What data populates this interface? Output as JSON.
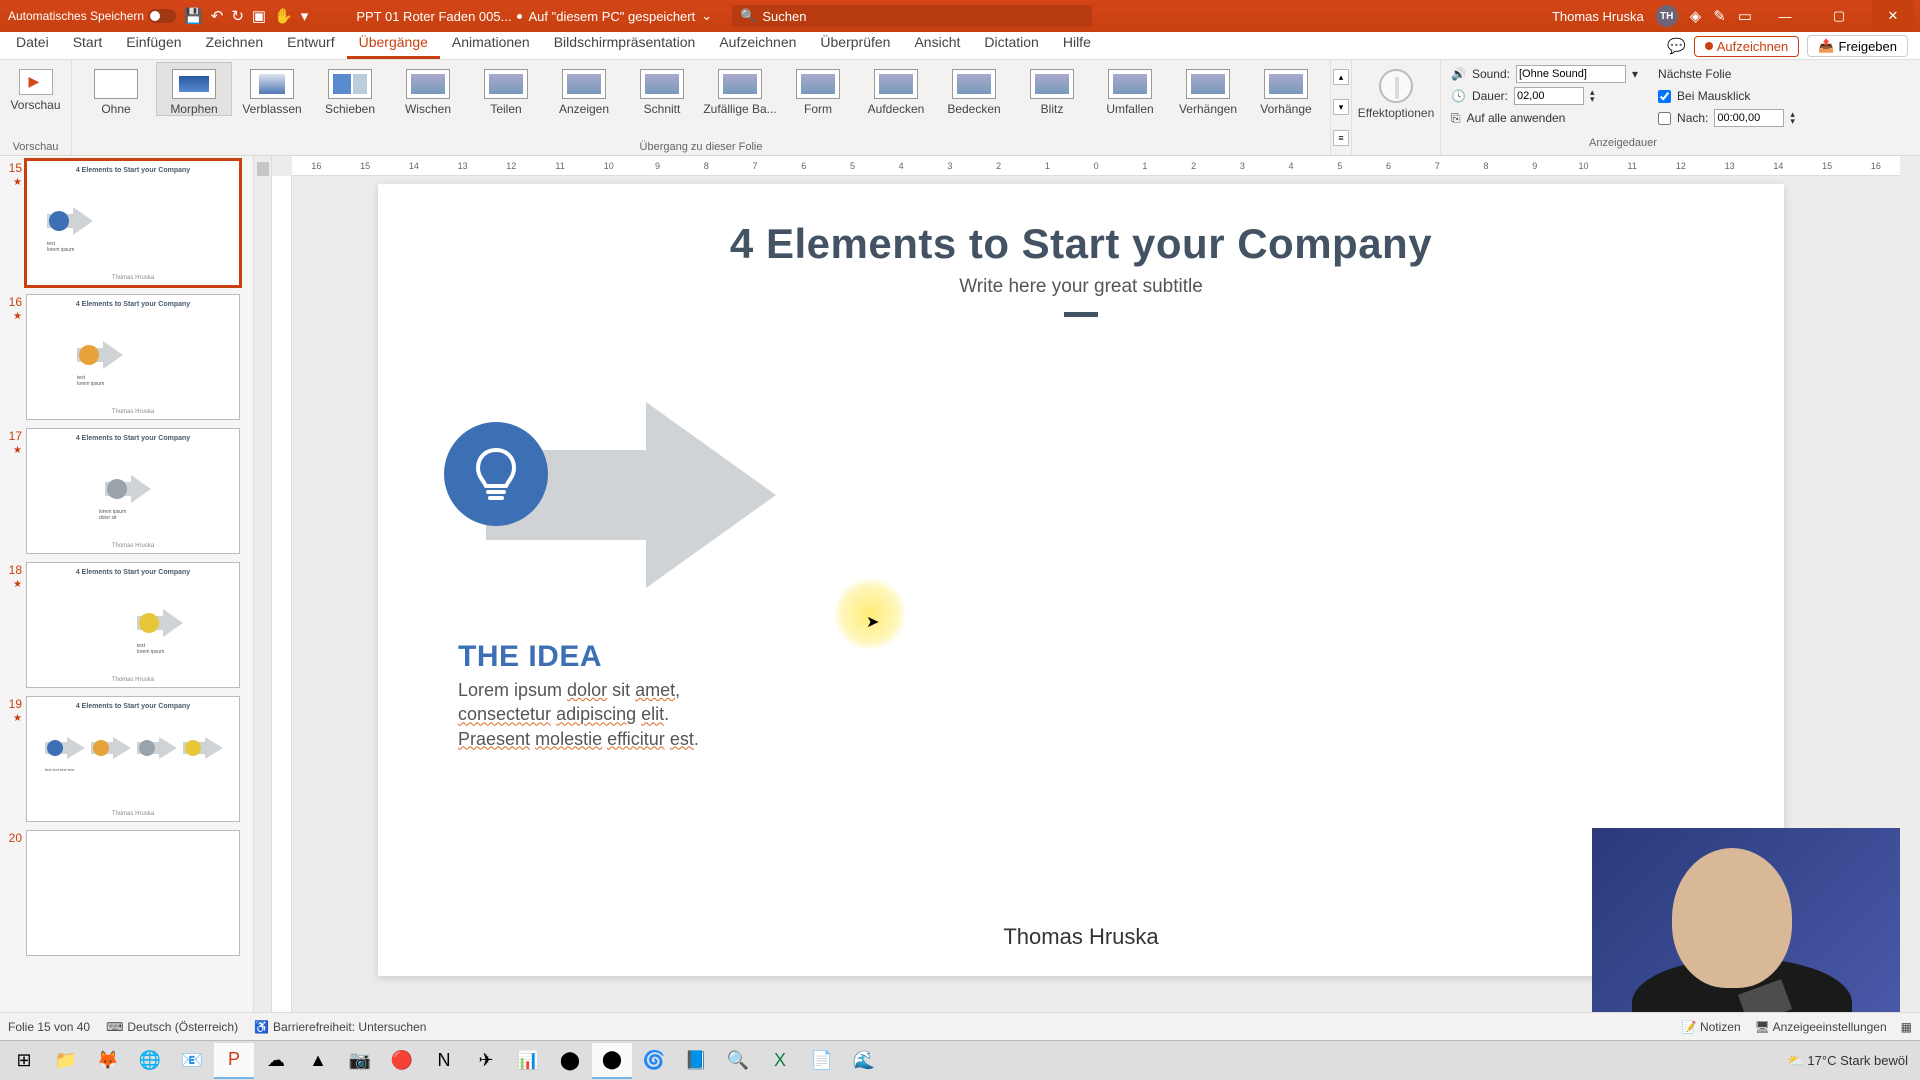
{
  "titlebar": {
    "autosave": "Automatisches Speichern",
    "docname": "PPT 01 Roter Faden 005...",
    "saved_state": "Auf \"diesem PC\" gespeichert",
    "search_placeholder": "Suchen",
    "user_name": "Thomas Hruska",
    "user_initials": "TH"
  },
  "tabs": [
    "Datei",
    "Start",
    "Einfügen",
    "Zeichnen",
    "Entwurf",
    "Übergänge",
    "Animationen",
    "Bildschirmpräsentation",
    "Aufzeichnen",
    "Überprüfen",
    "Ansicht",
    "Dictation",
    "Hilfe"
  ],
  "active_tab_index": 5,
  "record_btn": "Aufzeichnen",
  "share_btn": "Freigeben",
  "ribbon": {
    "preview": "Vorschau",
    "preview_group": "Vorschau",
    "transitions": [
      "Ohne",
      "Morphen",
      "Verblassen",
      "Schieben",
      "Wischen",
      "Teilen",
      "Anzeigen",
      "Schnitt",
      "Zufällige Ba...",
      "Form",
      "Aufdecken",
      "Bedecken",
      "Blitz",
      "Umfallen",
      "Verhängen",
      "Vorhänge"
    ],
    "selected_transition": 1,
    "transition_group": "Übergang zu dieser Folie",
    "effect_options": "Effektoptionen",
    "sound_label": "Sound:",
    "sound_value": "[Ohne Sound]",
    "duration_label": "Dauer:",
    "duration_value": "02,00",
    "apply_all": "Auf alle anwenden",
    "next_slide": "Nächste Folie",
    "on_click": "Bei Mausklick",
    "after_label": "Nach:",
    "after_value": "00:00,00",
    "timing_group": "Anzeigedauer"
  },
  "thumbs": [
    {
      "num": "15",
      "sel": true,
      "title": "4 Elements to Start your Company",
      "footer": "Thomas Hruska",
      "variant": "blue-single"
    },
    {
      "num": "16",
      "sel": false,
      "title": "4 Elements to Start your Company",
      "footer": "Thomas Hruska",
      "variant": "orange-single"
    },
    {
      "num": "17",
      "sel": false,
      "title": "4 Elements to Start your Company",
      "footer": "Thomas Hruska",
      "variant": "grey-single"
    },
    {
      "num": "18",
      "sel": false,
      "title": "4 Elements to Start your Company",
      "footer": "Thomas Hruska",
      "variant": "yellow-single"
    },
    {
      "num": "19",
      "sel": false,
      "title": "4 Elements to Start your Company",
      "footer": "Thomas Hruska",
      "variant": "four-row"
    },
    {
      "num": "20",
      "sel": false,
      "title": "",
      "footer": "",
      "variant": "blank"
    }
  ],
  "slide": {
    "title": "4 Elements to Start your Company",
    "subtitle": "Write here your great subtitle",
    "idea_head": "THE IDEA",
    "idea_l1_pre": "Lorem ipsum ",
    "idea_l1_u1": "dolor",
    "idea_l1_mid": " sit ",
    "idea_l1_u2": "amet",
    "idea_l1_post": ",",
    "idea_l2_u1": "consectetur",
    "idea_l2_mid": " ",
    "idea_l2_u2": "adipiscing",
    "idea_l2_mid2": " ",
    "idea_l2_u3": "elit",
    "idea_l2_post": ".",
    "idea_l3_u1": "Praesent",
    "idea_l3_mid": " ",
    "idea_l3_u2": "molestie",
    "idea_l3_mid2": " ",
    "idea_l3_u3": "efficitur",
    "idea_l3_mid3": " ",
    "idea_l3_u4": "est",
    "idea_l3_post": ".",
    "footer": "Thomas Hruska"
  },
  "status": {
    "slide_count": "Folie 15 von 40",
    "lang": "Deutsch (Österreich)",
    "accessibility": "Barrierefreiheit: Untersuchen",
    "notes": "Notizen",
    "display_settings": "Anzeigeeinstellungen"
  },
  "ruler_ticks": [
    "16",
    "15",
    "14",
    "13",
    "12",
    "11",
    "10",
    "9",
    "8",
    "7",
    "6",
    "5",
    "4",
    "3",
    "2",
    "1",
    "0",
    "1",
    "2",
    "3",
    "4",
    "5",
    "6",
    "7",
    "8",
    "9",
    "10",
    "11",
    "12",
    "13",
    "14",
    "15",
    "16"
  ],
  "taskbar_weather": {
    "temp": "17°C",
    "cond": "Stark bewöl"
  }
}
